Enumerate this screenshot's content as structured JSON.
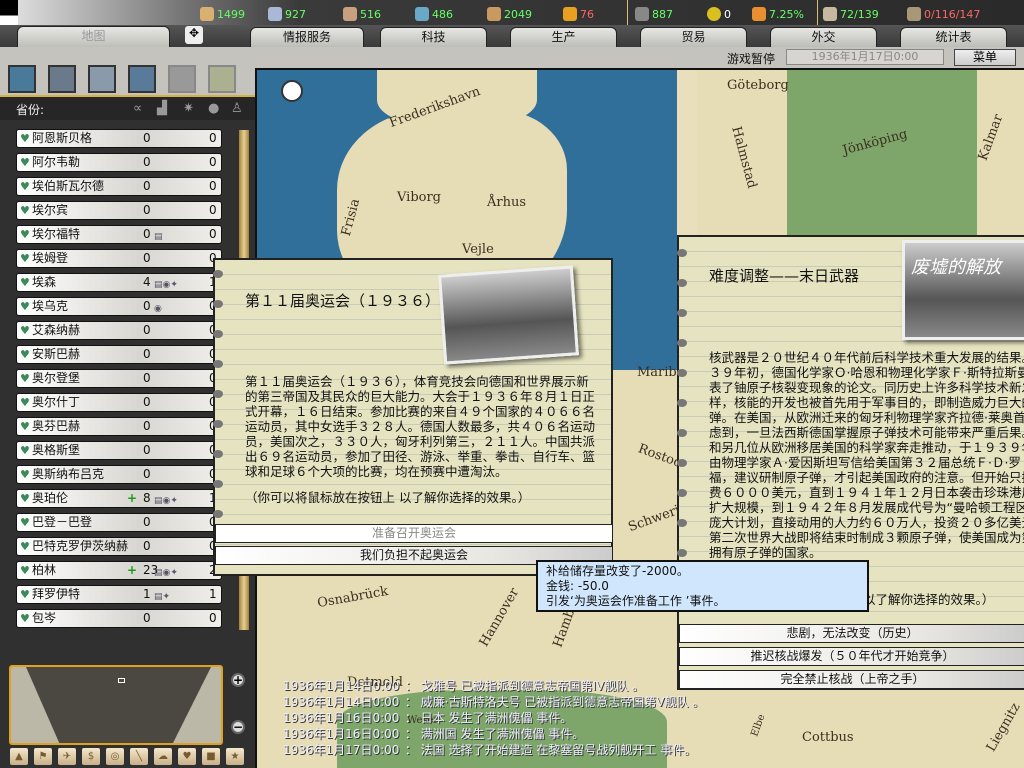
{
  "resources": [
    {
      "icon": "energy-icon",
      "value": "1499",
      "color": "#66ff66"
    },
    {
      "icon": "metal-icon",
      "value": "927",
      "color": "#66ff66"
    },
    {
      "icon": "rare-materials-icon",
      "value": "516",
      "color": "#66ff66"
    },
    {
      "icon": "oil-icon",
      "value": "486",
      "color": "#66ff66"
    },
    {
      "icon": "supplies-icon",
      "value": "2049",
      "color": "#66ff66"
    },
    {
      "icon": "money-icon",
      "value": "76",
      "color": "#ff6666"
    }
  ],
  "stats": [
    {
      "icon": "manpower-icon",
      "value": "887"
    },
    {
      "icon": "nuclear-icon",
      "value": "0"
    },
    {
      "icon": "dissent-icon",
      "value": "7.25%"
    },
    {
      "icon": "transport-icon",
      "value": "72/139"
    },
    {
      "icon": "convoy-icon",
      "value": "0/116/147"
    }
  ],
  "tabs": [
    "地图",
    "情报服务",
    "科技",
    "生产",
    "贸易",
    "外交",
    "统计表"
  ],
  "status": {
    "paused": "游戏暂停",
    "date": "1936年1月17日0:00",
    "menu": "菜单"
  },
  "provinces_header": "省份:",
  "provinces": [
    {
      "name": "阿恩斯贝格",
      "v1": "0",
      "v2": "0",
      "plus": "",
      "bld": ""
    },
    {
      "name": "阿尔韦勒",
      "v1": "0",
      "v2": "0",
      "plus": "",
      "bld": ""
    },
    {
      "name": "埃伯斯瓦尔德",
      "v1": "0",
      "v2": "0",
      "plus": "",
      "bld": ""
    },
    {
      "name": "埃尔宾",
      "v1": "0",
      "v2": "0",
      "plus": "",
      "bld": ""
    },
    {
      "name": "埃尔福特",
      "v1": "0",
      "v2": "0",
      "plus": "",
      "bld": "▤"
    },
    {
      "name": "埃姆登",
      "v1": "0",
      "v2": "0",
      "plus": "",
      "bld": ""
    },
    {
      "name": "埃森",
      "v1": "4",
      "v2": "1",
      "plus": "",
      "bld": "▤◉✦"
    },
    {
      "name": "埃乌克",
      "v1": "0",
      "v2": "0",
      "plus": "",
      "bld": "◉"
    },
    {
      "name": "艾森纳赫",
      "v1": "0",
      "v2": "0",
      "plus": "",
      "bld": ""
    },
    {
      "name": "安斯巴赫",
      "v1": "0",
      "v2": "0",
      "plus": "",
      "bld": ""
    },
    {
      "name": "奥尔登堡",
      "v1": "0",
      "v2": "0",
      "plus": "",
      "bld": ""
    },
    {
      "name": "奥尔什丁",
      "v1": "0",
      "v2": "0",
      "plus": "",
      "bld": ""
    },
    {
      "name": "奥芬巴赫",
      "v1": "0",
      "v2": "0",
      "plus": "",
      "bld": ""
    },
    {
      "name": "奥格斯堡",
      "v1": "0",
      "v2": "0",
      "plus": "",
      "bld": ""
    },
    {
      "name": "奥斯纳布吕克",
      "v1": "0",
      "v2": "0",
      "plus": "",
      "bld": ""
    },
    {
      "name": "奥珀伦",
      "v1": "8",
      "v2": "1",
      "plus": "+",
      "bld": "▤◉✦"
    },
    {
      "name": "巴登－巴登",
      "v1": "0",
      "v2": "0",
      "plus": "",
      "bld": ""
    },
    {
      "name": "巴特克罗伊茨纳赫",
      "v1": "0",
      "v2": "0",
      "plus": "",
      "bld": ""
    },
    {
      "name": "柏林",
      "v1": "23",
      "v2": "2",
      "plus": "+",
      "bld": "▤◉✦"
    },
    {
      "name": "拜罗伊特",
      "v1": "1",
      "v2": "1",
      "plus": "",
      "bld": "▤✦"
    },
    {
      "name": "包岑",
      "v1": "0",
      "v2": "0",
      "plus": "",
      "bld": ""
    }
  ],
  "map_labels": [
    "Frederikshavn",
    "Viborg",
    "Århus",
    "Frisia",
    "Vejle",
    "Göteborg",
    "Halmstad",
    "Jönköping",
    "Kalmar",
    "Osnabrück",
    "Hannover",
    "Schwerin",
    "Rostock",
    "Detmold",
    "Cottbus",
    "Liegnitz",
    "Maribo",
    "Hamburg",
    "Weser",
    "Elbe"
  ],
  "event1": {
    "title": "第１１届奥运会（１９３６）",
    "body": [
      "第１１届奥运会（１９３６），体育竞技会向德国和世界展示新",
      "的第三帝国及其民众的巨大能力。大会于１９３６年８月１日正",
      "式开幕，１６日结束。参加比赛的来自４９个国家的４０６６名",
      "运动员，其中女选手３２８人。德国人数最多，共４０６名运动",
      "员，美国次之，３３０人，匈牙利列第三，２１１人。中国共派",
      "出６９名运动员，参加了田径、游泳、举重、拳击、自行车、篮",
      "球和足球６个大项的比赛，均在预赛中遭淘汰。"
    ],
    "hint": "（你可以将鼠标放在按钮上 以了解你选择的效果。）",
    "options": [
      "准备召开奥运会",
      "我们负担不起奥运会"
    ]
  },
  "event2": {
    "title": "难度调整——末日武器",
    "photo_caption": "废墟的解放",
    "body": [
      "核武器是２０世纪４０年代前后科学技术重大发展的结果。１",
      "３９年初，德国化学家Ｏ·哈恩和物理化学家Ｆ·斯特拉斯曼发",
      "表了铀原子核裂变现象的论文。同历史上许多科学技术新发明一",
      "样，核能的开发也被首先用于军事目的，即制造威力巨大的原子",
      "弹。在美国，从欧洲迁来的匈牙利物理学家齐拉德·莱奥首先",
      "虑到，一旦法西斯德国掌握原子弹技术可能带来严重后果。经",
      "和另几位从欧洲移居美国的科学家奔走推动，于１９３９年８",
      "由物理学家Ａ·爱因斯坦写信给美国第３２届总统Ｆ·Ｄ·罗",
      "福，建议研制原子弹，才引起美国政府的注意。但开始只拨给",
      "费６０００美元，直到１９４１年１２月日本袭击珍珠港后才",
      "扩大规模，到１９４２年８月发展成代号为“曼哈顿工程区”",
      "庞大计划，直接动用的人力约６０万人，投资２０多亿美元。",
      "第二次世界大战即将结束时制成３颗原子弹，使美国成为第一",
      "拥有原子弹的国家。"
    ],
    "hint": "（你可以将鼠标放在按钮上 以了解你选择的效果。）",
    "options": [
      "悲剧，无法改变（历史）",
      "推迟核战爆发（５０年代才开始竞争）",
      "完全禁止核战（上帝之手）"
    ]
  },
  "tooltip": [
    "补给储存量改变了-2000。",
    "金钱: -50.0",
    "引发‘为奥运会作准备工作 ’事件。"
  ],
  "log": [
    {
      "date": "1936年1月14日0:00",
      "text": "戈雅号 已被指派到德意志帝国第IV舰队 。"
    },
    {
      "date": "1936年1月14日0:00",
      "text": "威廉·古斯特洛夫号 已被指派到德意志帝国第V舰队 。"
    },
    {
      "date": "1936年1月16日0:00",
      "text": "日本 发生了满洲傀儡 事件。"
    },
    {
      "date": "1936年1月16日0:00",
      "text": "满洲国 发生了满洲傀儡 事件。"
    },
    {
      "date": "1936年1月17日0:00",
      "text": "法国 选择了开始建造 在黎塞留号战列舰开工 事件。"
    }
  ]
}
